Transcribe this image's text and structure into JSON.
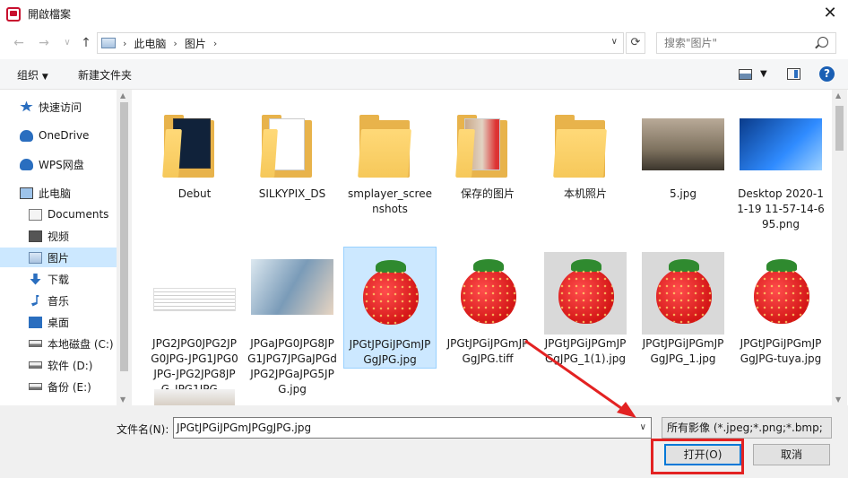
{
  "window": {
    "title": "開啟檔案",
    "close_label": "✕"
  },
  "nav": {
    "back": "←",
    "forward": "→",
    "recent": "∨",
    "up": "↑",
    "breadcrumbs": [
      "此电脑",
      "图片"
    ],
    "search_placeholder": "搜索\"图片\""
  },
  "toolbar": {
    "organize": "组织",
    "new_folder": "新建文件夹",
    "help": "?"
  },
  "sidebar": {
    "items": [
      {
        "label": "快速访问",
        "icon": "star-icon"
      },
      {
        "label": "OneDrive",
        "icon": "cloud-icon"
      },
      {
        "label": "WPS网盘",
        "icon": "cloud-icon"
      },
      {
        "label": "此电脑",
        "icon": "computer-icon"
      },
      {
        "label": "Documents",
        "icon": "document-icon"
      },
      {
        "label": "视频",
        "icon": "video-icon"
      },
      {
        "label": "图片",
        "icon": "picture-icon",
        "selected": true
      },
      {
        "label": "下载",
        "icon": "download-icon"
      },
      {
        "label": "音乐",
        "icon": "music-icon"
      },
      {
        "label": "桌面",
        "icon": "desktop-icon"
      },
      {
        "label": "本地磁盘 (C:)",
        "icon": "drive-icon"
      },
      {
        "label": "软件 (D:)",
        "icon": "drive-icon"
      },
      {
        "label": "备份 (E:)",
        "icon": "drive-icon"
      }
    ]
  },
  "files": [
    {
      "name": "Debut",
      "kind": "folder-dark"
    },
    {
      "name": "SILKYPIX_DS",
      "kind": "folder-paper"
    },
    {
      "name": "smplayer_screenshots",
      "kind": "folder"
    },
    {
      "name": "保存的图片",
      "kind": "folder-photo"
    },
    {
      "name": "本机照片",
      "kind": "folder"
    },
    {
      "name": "5.jpg",
      "kind": "photo-fog"
    },
    {
      "name": "Desktop 2020-11-19 11-57-14-695.png",
      "kind": "photo-desktop"
    },
    {
      "name": "JPG2JPG0JPG2JPG0JPG-JPG1JPG0JPG-JPG2JPG8JPG_JPG1JPG...",
      "kind": "doc"
    },
    {
      "name": "JPGaJPG0JPG8JPG1JPG7JPGaJPGdJPG2JPGaJPG5JPG.jpg",
      "kind": "photo-person"
    },
    {
      "name": "JPGtJPGiJPGmJPGgJPG.jpg",
      "kind": "strawberry",
      "selected": true
    },
    {
      "name": "JPGtJPGiJPGmJPGgJPG.tiff",
      "kind": "strawberry"
    },
    {
      "name": "JPGtJPGiJPGmJPGgJPG_1(1).jpg",
      "kind": "strawberry-gray"
    },
    {
      "name": "JPGtJPGiJPGmJPGgJPG_1.jpg",
      "kind": "strawberry-gray"
    },
    {
      "name": "JPGtJPGiJPGmJPGgJPG-tuya.jpg",
      "kind": "strawberry"
    }
  ],
  "bottom": {
    "filename_label": "文件名(N):",
    "filename_value": "JPGtJPGiJPGmJPGgJPG.jpg",
    "filter": "所有影像 (*.jpeg;*.png;*.bmp;",
    "open": "打开(O)",
    "cancel": "取消"
  }
}
